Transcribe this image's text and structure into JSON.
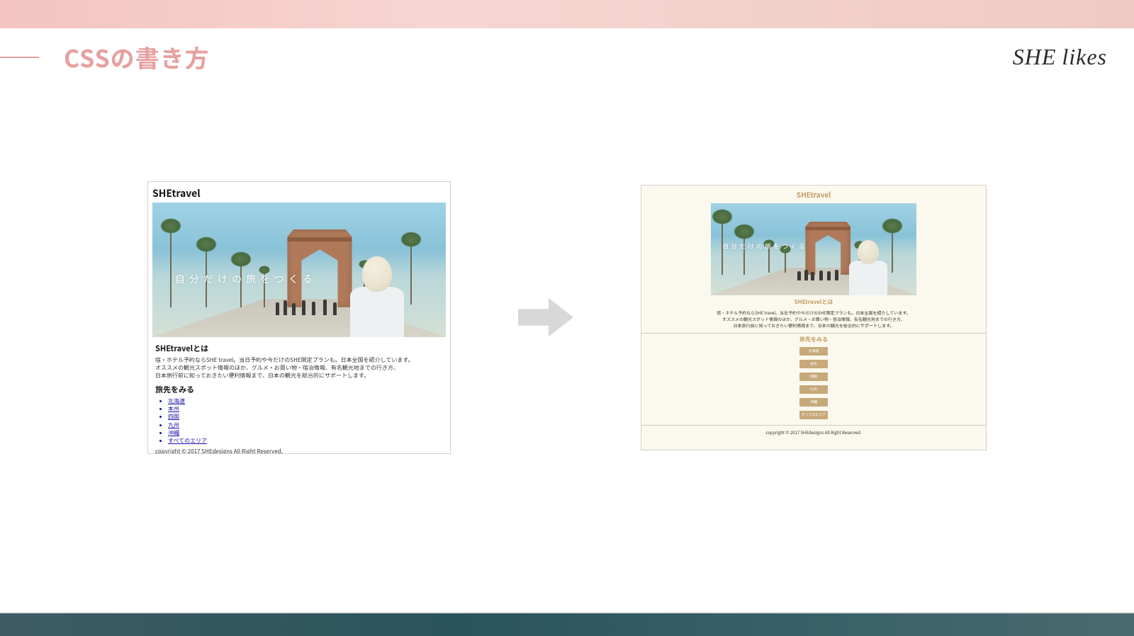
{
  "slide": {
    "title": "CSSの書き方",
    "brand_she": "SHE",
    "brand_likes": "likes"
  },
  "hero_caption": "自分だけの旅をつくる",
  "left_panel": {
    "site_title": "SHEtravel",
    "section_about": "SHEtravelとは",
    "desc1": "宿・ホテル予約ならSHE travel。当日予約や今だけのSHE限定プランも。日本全国を紹介しています。",
    "desc2": "オススメの観光スポット情報のほか、グルメ・お買い物・宿泊情報、有名観光地までの行き方、",
    "desc3": "日本旅行前に知っておきたい便利情報まで、日本の観光を総合的にサポートします。",
    "section_dest": "旅先をみる",
    "links": [
      "北海道",
      "本州",
      "四国",
      "九州",
      "沖縄",
      "すべてのエリア"
    ],
    "copyright": "copyright © 2017 SHEdesigns All Right Reserved."
  },
  "right_panel": {
    "site_title": "SHEtravel",
    "section_about": "SHEtravelとは",
    "desc1": "宿・ホテル予約ならSHE travel。当日予約や今だけのSHE限定プランも。日本全国を紹介しています。",
    "desc2": "オススメの観光スポット情報のほか、グルメ・お買い物・宿泊情報、有名観光地までの行き方、",
    "desc3": "日本旅行前に知っておきたい便利情報まで、日本の観光を総合的にサポートします。",
    "section_dest": "旅先をみる",
    "links": [
      "北海道",
      "本州",
      "四国",
      "九州",
      "沖縄",
      "すべてのエリア"
    ],
    "copyright": "copyright © 2017 SHEdesigns All Right Reserved."
  }
}
